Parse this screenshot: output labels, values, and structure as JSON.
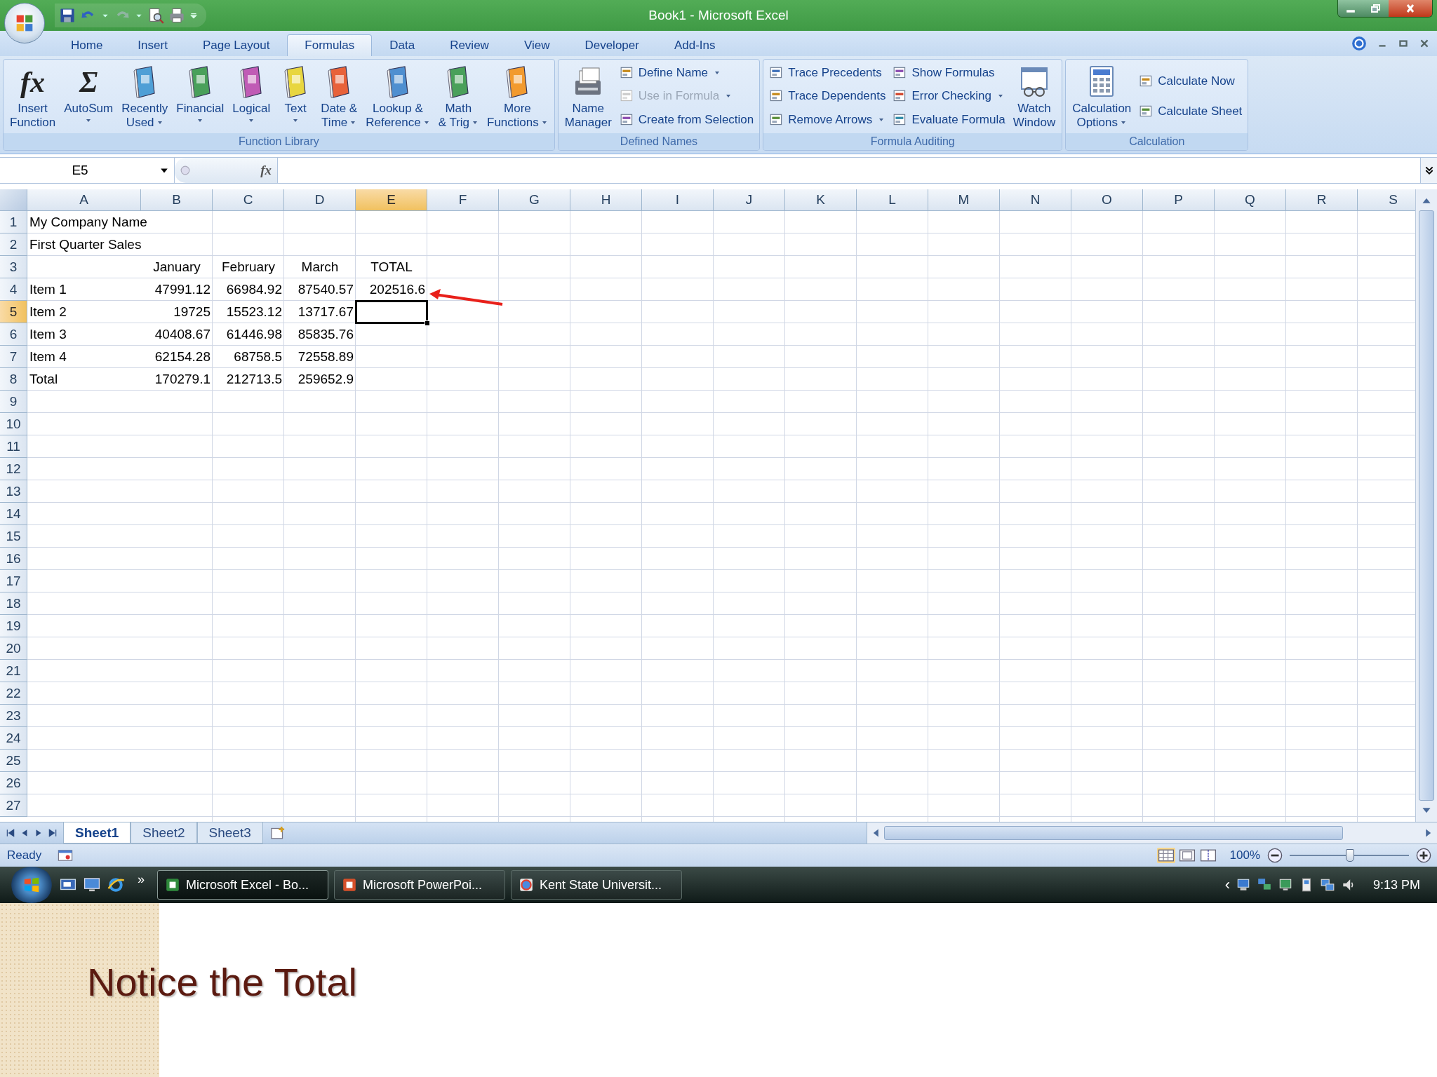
{
  "window": {
    "title": "Book1 - Microsoft Excel"
  },
  "tabs": [
    {
      "label": "Home",
      "selected": false
    },
    {
      "label": "Insert",
      "selected": false
    },
    {
      "label": "Page Layout",
      "selected": false
    },
    {
      "label": "Formulas",
      "selected": true
    },
    {
      "label": "Data",
      "selected": false
    },
    {
      "label": "Review",
      "selected": false
    },
    {
      "label": "View",
      "selected": false
    },
    {
      "label": "Developer",
      "selected": false
    },
    {
      "label": "Add-Ins",
      "selected": false
    }
  ],
  "ribbon": {
    "groups": [
      {
        "title": "Function Library",
        "items": [
          {
            "kind": "large",
            "lines": [
              "Insert",
              "Function"
            ],
            "glyph": "fx",
            "dropdown": false,
            "disabled": false
          },
          {
            "kind": "large",
            "lines": [
              "AutoSum"
            ],
            "glyph": "Σ",
            "dropdown": true,
            "disabled": false
          },
          {
            "kind": "large",
            "lines": [
              "Recently",
              "Used"
            ],
            "dropdown": true,
            "disabled": false
          },
          {
            "kind": "large",
            "lines": [
              "Financial"
            ],
            "dropdown": true,
            "disabled": false
          },
          {
            "kind": "large",
            "lines": [
              "Logical"
            ],
            "dropdown": true,
            "disabled": false
          },
          {
            "kind": "large",
            "lines": [
              "Text"
            ],
            "dropdown": true,
            "disabled": false
          },
          {
            "kind": "large",
            "lines": [
              "Date &",
              "Time"
            ],
            "dropdown": true,
            "disabled": false
          },
          {
            "kind": "large",
            "lines": [
              "Lookup &",
              "Reference"
            ],
            "dropdown": true,
            "disabled": false
          },
          {
            "kind": "large",
            "lines": [
              "Math",
              "& Trig"
            ],
            "dropdown": true,
            "disabled": false
          },
          {
            "kind": "large",
            "lines": [
              "More",
              "Functions"
            ],
            "dropdown": true,
            "disabled": false
          }
        ]
      },
      {
        "title": "Defined Names",
        "items": [
          {
            "kind": "large",
            "lines": [
              "Name",
              "Manager"
            ],
            "dropdown": false,
            "disabled": false
          },
          {
            "kind": "small",
            "label": "Define Name",
            "dropdown": true,
            "disabled": false
          },
          {
            "kind": "small",
            "label": "Use in Formula",
            "dropdown": true,
            "disabled": true
          },
          {
            "kind": "small",
            "label": "Create from Selection",
            "dropdown": false,
            "disabled": false
          }
        ]
      },
      {
        "title": "Formula Auditing",
        "items": [
          {
            "kind": "small",
            "label": "Trace Precedents",
            "dropdown": false,
            "disabled": false
          },
          {
            "kind": "small",
            "label": "Trace Dependents",
            "dropdown": false,
            "disabled": false
          },
          {
            "kind": "small",
            "label": "Remove Arrows",
            "dropdown": true,
            "disabled": false
          },
          {
            "kind": "small",
            "label": "Show Formulas",
            "dropdown": false,
            "disabled": false
          },
          {
            "kind": "small",
            "label": "Error Checking",
            "dropdown": true,
            "disabled": false
          },
          {
            "kind": "small",
            "label": "Evaluate Formula",
            "dropdown": false,
            "disabled": false
          },
          {
            "kind": "large",
            "lines": [
              "Watch",
              "Window"
            ],
            "dropdown": false,
            "disabled": false
          }
        ]
      },
      {
        "title": "Calculation",
        "items": [
          {
            "kind": "large",
            "lines": [
              "Calculation",
              "Options"
            ],
            "dropdown": true,
            "disabled": false
          },
          {
            "kind": "small",
            "label": "Calculate Now",
            "dropdown": false,
            "disabled": false
          },
          {
            "kind": "small",
            "label": "Calculate Sheet",
            "dropdown": false,
            "disabled": false
          }
        ]
      }
    ]
  },
  "formula_bar": {
    "name_box": "E5",
    "fx": "fx"
  },
  "columns": [
    {
      "letter": "A",
      "selected": false
    },
    {
      "letter": "B",
      "selected": false
    },
    {
      "letter": "C",
      "selected": false
    },
    {
      "letter": "D",
      "selected": false
    },
    {
      "letter": "E",
      "selected": true
    },
    {
      "letter": "F",
      "selected": false
    },
    {
      "letter": "G",
      "selected": false
    },
    {
      "letter": "H",
      "selected": false
    },
    {
      "letter": "I",
      "selected": false
    },
    {
      "letter": "J",
      "selected": false
    },
    {
      "letter": "K",
      "selected": false
    },
    {
      "letter": "L",
      "selected": false
    },
    {
      "letter": "M",
      "selected": false
    },
    {
      "letter": "N",
      "selected": false
    },
    {
      "letter": "O",
      "selected": false
    },
    {
      "letter": "P",
      "selected": false
    },
    {
      "letter": "Q",
      "selected": false
    },
    {
      "letter": "R",
      "selected": false
    },
    {
      "letter": "S",
      "selected": false
    }
  ],
  "rows": [
    {
      "number": "1",
      "kind": "data",
      "selected": false,
      "cells": {
        "A": "My Company Name"
      }
    },
    {
      "number": "2",
      "kind": "data",
      "selected": false,
      "cells": {
        "A": "First Quarter Sales"
      }
    },
    {
      "number": "3",
      "kind": "header",
      "selected": false,
      "cells": {
        "B": "January",
        "C": "February",
        "D": "March",
        "E": "TOTAL"
      }
    },
    {
      "number": "4",
      "kind": "data",
      "selected": false,
      "cells": {
        "A": "Item 1",
        "B": "47991.12",
        "C": "66984.92",
        "D": "87540.57",
        "E": "202516.6"
      }
    },
    {
      "number": "5",
      "kind": "data",
      "selected": true,
      "cells": {
        "A": "Item 2",
        "B": "19725",
        "C": "15523.12",
        "D": "13717.67"
      }
    },
    {
      "number": "6",
      "kind": "data",
      "selected": false,
      "cells": {
        "A": "Item 3",
        "B": "40408.67",
        "C": "61446.98",
        "D": "85835.76"
      }
    },
    {
      "number": "7",
      "kind": "data",
      "selected": false,
      "cells": {
        "A": "Item 4",
        "B": "62154.28",
        "C": "68758.5",
        "D": "72558.89"
      }
    },
    {
      "number": "8",
      "kind": "data",
      "selected": false,
      "cells": {
        "A": "Total",
        "B": "170279.1",
        "C": "212713.5",
        "D": "259652.9"
      }
    },
    {
      "number": "9",
      "selected": false
    },
    {
      "number": "10",
      "selected": false
    },
    {
      "number": "11",
      "selected": false
    },
    {
      "number": "12",
      "selected": false
    },
    {
      "number": "13",
      "selected": false
    },
    {
      "number": "14",
      "selected": false
    },
    {
      "number": "15",
      "selected": false
    },
    {
      "number": "16",
      "selected": false
    },
    {
      "number": "17",
      "selected": false
    },
    {
      "number": "18",
      "selected": false
    },
    {
      "number": "19",
      "selected": false
    },
    {
      "number": "20",
      "selected": false
    },
    {
      "number": "21",
      "selected": false
    },
    {
      "number": "22",
      "selected": false
    },
    {
      "number": "23",
      "selected": false
    },
    {
      "number": "24",
      "selected": false
    },
    {
      "number": "25",
      "selected": false
    },
    {
      "number": "26",
      "selected": false
    },
    {
      "number": "27",
      "selected": false
    }
  ],
  "sheet_tabs": [
    {
      "label": "Sheet1",
      "selected": true
    },
    {
      "label": "Sheet2",
      "selected": false
    },
    {
      "label": "Sheet3",
      "selected": false
    }
  ],
  "status_bar": {
    "status": "Ready",
    "zoom": "100%",
    "zoom_slider": {
      "level": 0.5
    }
  },
  "taskbar": {
    "more": "»",
    "tasks": [
      {
        "label": "Microsoft Excel - Bo...",
        "selected": true
      },
      {
        "label": "Microsoft PowerPoi...",
        "selected": false
      },
      {
        "label": "Kent State Universit...",
        "selected": false
      }
    ],
    "tray_toggle": "‹",
    "time": "9:13 PM"
  },
  "caption": "Notice the Total"
}
